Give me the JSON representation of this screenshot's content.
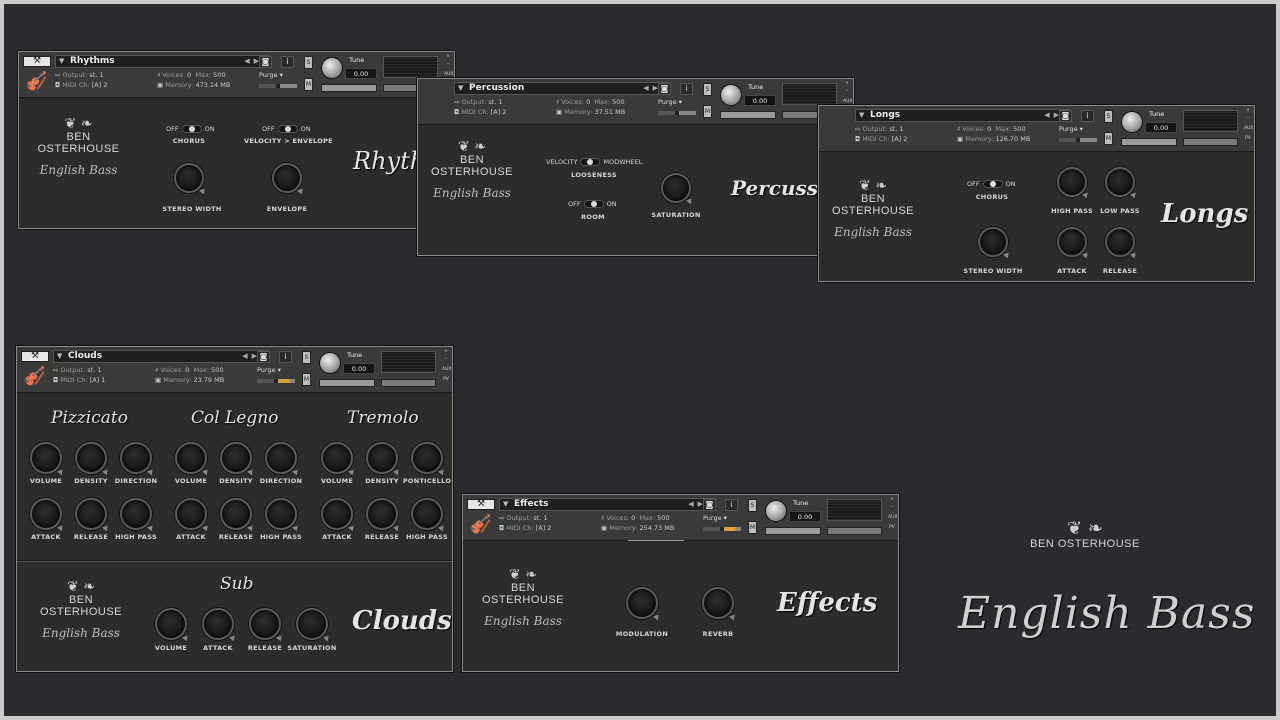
{
  "common": {
    "output_label": "Output:",
    "output_value": "st. 1",
    "midi_label": "MIDI Ch:",
    "voices_label": "Voices:",
    "voices_value": "0",
    "max_label": "Max:",
    "max_value": "500",
    "memory_label": "Memory:",
    "purge_label": "Purge",
    "tune_label": "Tune",
    "tune_value": "0.00",
    "s_label": "S",
    "m_label": "M",
    "aux_label": "AUX",
    "pv_label": "PV",
    "close_glyph": "×",
    "min_glyph": "–",
    "off": "OFF",
    "on": "ON"
  },
  "rhythms": {
    "name": "Rhythms",
    "midi_value": "[A]  2",
    "memory_value": "473.14 MB",
    "chorus_label": "CHORUS",
    "vel_env_label": "VELOCITY > ENVELOPE",
    "stereo_width_label": "STEREO WIDTH",
    "envelope_label": "ENVELOPE",
    "title": "Rhythms"
  },
  "percussion": {
    "name": "Percussion",
    "midi_value": "[A]  2",
    "memory_value": "37.51 MB",
    "velocity_label": "VELOCITY",
    "modwheel_label": "MODWHEEL",
    "looseness_label": "LOOSENESS",
    "room_label": "ROOM",
    "saturation_label": "SATURATION",
    "title": "Percussion"
  },
  "longs": {
    "name": "Longs",
    "midi_value": "[A]  2",
    "memory_value": "126.70 MB",
    "chorus_label": "CHORUS",
    "high_pass_label": "HIGH PASS",
    "low_pass_label": "LOW PASS",
    "stereo_width_label": "STEREO WIDTH",
    "attack_label": "ATTACK",
    "release_label": "RELEASE",
    "title": "Longs"
  },
  "clouds": {
    "name": "Clouds",
    "midi_value": "[A]  1",
    "memory_value": "23.79 MB",
    "pizzicato": "Pizzicato",
    "col_legno": "Col Legno",
    "tremolo": "Tremolo",
    "volume": "VOLUME",
    "density": "DENSITY",
    "direction": "DIRECTION",
    "ponticello": "PONTICELLO",
    "attack": "ATTACK",
    "release": "RELEASE",
    "high_pass": "HIGH PASS",
    "saturation": "SATURATION",
    "sub": "Sub",
    "title": "Clouds"
  },
  "effects": {
    "name": "Effects",
    "midi_value": "[A]  2",
    "memory_value": "254.73 MB",
    "modulation_label": "MODULATION",
    "reverb_label": "REVERB",
    "title": "Effects"
  },
  "brand": {
    "name": "BEN OSTERHOUSE",
    "product": "English Bass",
    "ornament": "❦ ❧"
  },
  "colors": {
    "background": "#2a2b2e",
    "panel": "#2d2c2a",
    "header": "#3a3a3a",
    "meter_orange": "#e0a030"
  }
}
